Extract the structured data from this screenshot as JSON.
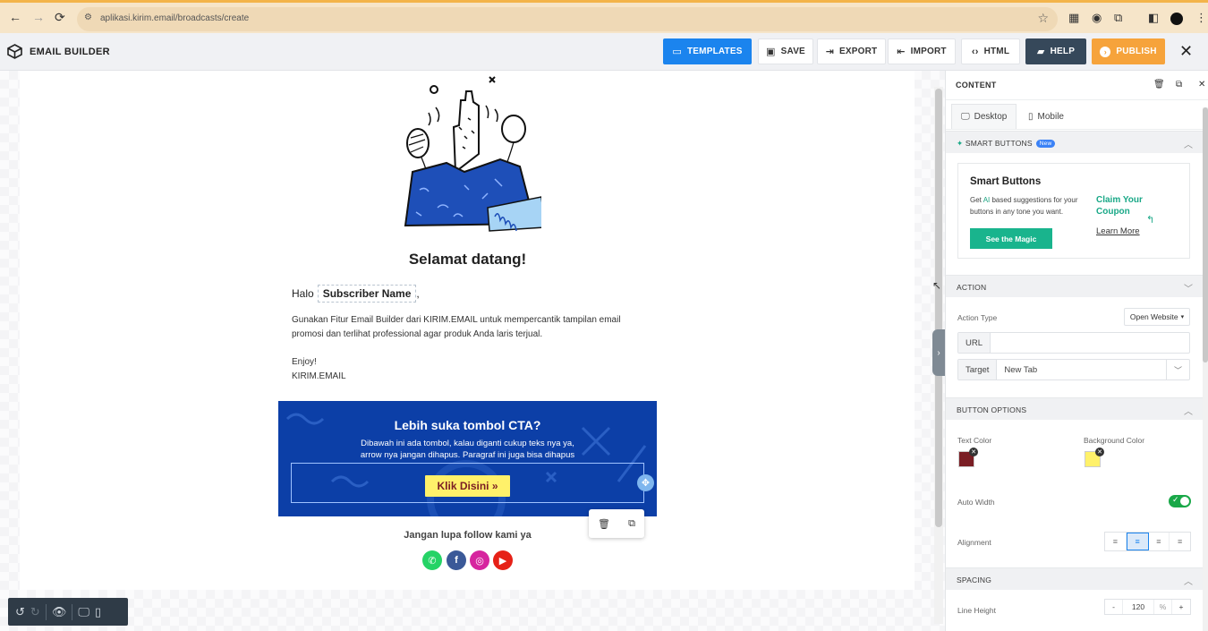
{
  "browser": {
    "url": "aplikasi.kirim.email/broadcasts/create",
    "nav_back": "←",
    "nav_forward": "→",
    "nav_reload": "⟳"
  },
  "header": {
    "title": "EMAIL BUILDER",
    "buttons": {
      "templates": "TEMPLATES",
      "save": "SAVE",
      "export": "EXPORT",
      "import": "IMPORT",
      "html": "HTML",
      "help": "HELP",
      "publish": "PUBLISH"
    }
  },
  "email": {
    "title": "Selamat datang!",
    "greeting": "Halo",
    "merge_tag": "Subscriber Name",
    "greeting_suffix": ",",
    "paragraph": "Gunakan Fitur Email Builder dari KIRIM.EMAIL untuk mempercantik tampilan email promosi dan terlihat professional agar produk Anda laris terjual.",
    "signoff": "Enjoy!",
    "signature": "KIRIM.EMAIL",
    "cta": {
      "title": "Lebih suka tombol CTA?",
      "subtitle": "Dibawah ini ada tombol, kalau diganti cukup teks nya ya, arrow nya jangan dihapus. Paragraf ini juga bisa dihapus",
      "button": "Klik Disini »"
    },
    "follow": "Jangan lupa follow kami ya",
    "social": [
      {
        "name": "whatsapp",
        "color": "#25d366"
      },
      {
        "name": "facebook",
        "color": "#3b5998"
      },
      {
        "name": "instagram",
        "color": "#d6249f"
      },
      {
        "name": "youtube",
        "color": "#e62117"
      }
    ]
  },
  "panel": {
    "header": "CONTENT",
    "tabs": {
      "desktop": "Desktop",
      "mobile": "Mobile"
    },
    "smart": {
      "section": "SMART BUTTONS",
      "badge": "New",
      "title": "Smart Buttons",
      "text_pre": "Get ",
      "text_ai": "AI",
      "text_post": " based suggestions for your buttons in any tone you want.",
      "button": "See the Magic",
      "claim": "Claim Your Coupon",
      "learn": "Learn More"
    },
    "action": {
      "section": "ACTION",
      "type_label": "Action Type",
      "type_value": "Open Website",
      "url_label": "URL",
      "url_value": "",
      "target_label": "Target",
      "target_value": "New Tab"
    },
    "button_options": {
      "section": "BUTTON OPTIONS",
      "text_color_label": "Text Color",
      "text_color": "#7a1e24",
      "bg_color_label": "Background Color",
      "bg_color": "#fff16a",
      "auto_width_label": "Auto Width",
      "auto_width": true,
      "alignment_label": "Alignment",
      "alignment": "center"
    },
    "spacing": {
      "section": "SPACING",
      "line_height_label": "Line Height",
      "line_height_value": "120",
      "unit": "%",
      "minus": "-",
      "plus": "+"
    }
  },
  "colors": {
    "accent": "#1b84ee",
    "publish": "#f6a33b",
    "help": "#36485a",
    "cta_bg": "#0c3fa7"
  }
}
